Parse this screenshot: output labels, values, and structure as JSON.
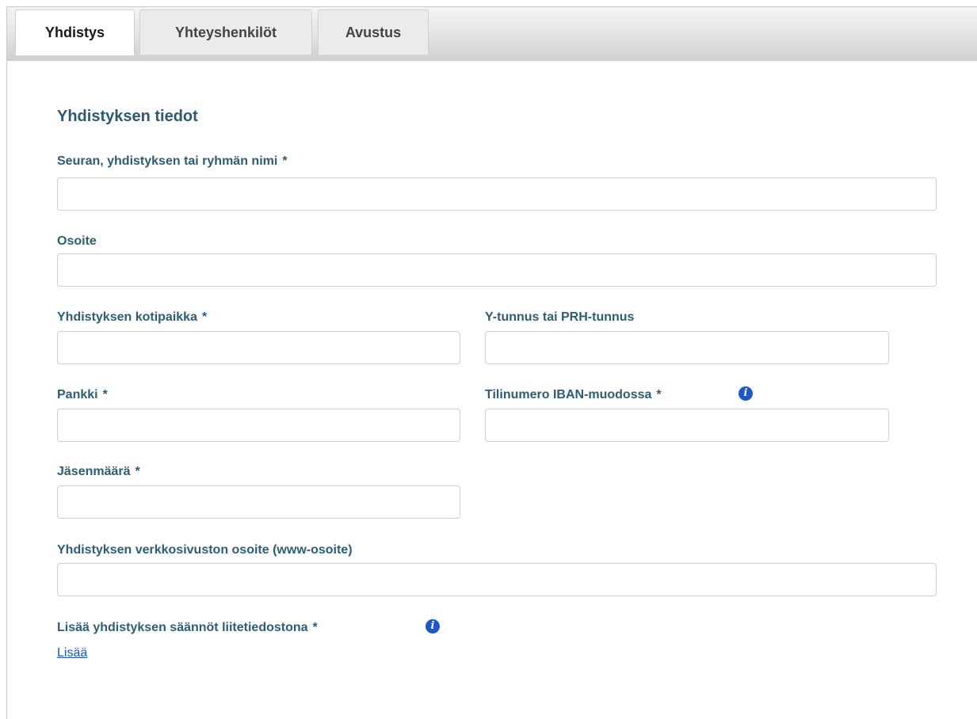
{
  "tabs": [
    {
      "label": "Yhdistys",
      "active": true
    },
    {
      "label": "Yhteyshenkilöt",
      "active": false
    },
    {
      "label": "Avustus",
      "active": false
    }
  ],
  "section_title": "Yhdistyksen tiedot",
  "required_mark": "*",
  "fields": {
    "name": {
      "label": "Seuran, yhdistyksen tai ryhmän nimi",
      "required": true,
      "value": ""
    },
    "address": {
      "label": "Osoite",
      "required": false,
      "value": ""
    },
    "home_city": {
      "label": "Yhdistyksen kotipaikka",
      "required": true,
      "value": ""
    },
    "business_id": {
      "label": "Y-tunnus tai PRH-tunnus",
      "required": false,
      "value": ""
    },
    "bank": {
      "label": "Pankki",
      "required": true,
      "value": ""
    },
    "iban": {
      "label": "Tilinumero IBAN-muodossa",
      "required": true,
      "value": "",
      "has_info": true
    },
    "members": {
      "label": "Jäsenmäärä",
      "required": true,
      "value": ""
    },
    "website": {
      "label": "Yhdistyksen verkkosivuston osoite (www-osoite)",
      "required": false,
      "value": ""
    }
  },
  "attachment": {
    "label": "Lisää yhdistyksen säännöt liitetiedostona",
    "required": true,
    "has_info": true,
    "link_label": "Lisää"
  },
  "icons": {
    "info": "info-circle-icon"
  },
  "colors": {
    "label": "#2d5d72",
    "link": "#1a56c9",
    "info_icon": "#1f56c9",
    "input_border": "#cfcfcf"
  }
}
